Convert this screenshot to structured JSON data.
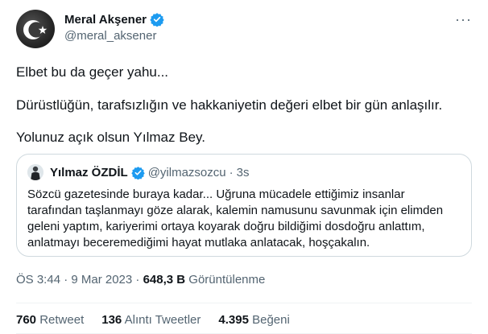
{
  "author": {
    "name": "Meral Akşener",
    "handle": "@meral_aksener",
    "verified_color": "#1d9bf0",
    "avatar_icon": "crescent-star-icon"
  },
  "tweet": {
    "lines": [
      "Elbet bu da geçer yahu...",
      "Dürüstlüğün, tarafsızlığın ve hakkaniyetin değeri elbet bir gün anlaşılır.",
      "Yolunuz açık olsun Yılmaz Bey."
    ]
  },
  "quote": {
    "name": "Yılmaz ÖZDİL",
    "handle": "@yilmazsozcu",
    "dot": "·",
    "time": "3s",
    "lines": [
      "Sözcü gazetesinde buraya kadar... Uğruna mücadele ettiğimiz insanlar",
      "tarafından taşlanmayı göze alarak, kalemin namusunu savunmak için elimden",
      "geleni yaptım, kariyerimi ortaya koyarak doğru bildiğimi dosdoğru anlattım,",
      "anlatmayı beceremediğimi hayat mutlaka anlatacak, hoşçakalın."
    ]
  },
  "meta": {
    "time_date": "ÖS 3:44 · 9 Mar 2023 · ",
    "views_count": "648,3 B",
    "views_label": " Görüntülenme"
  },
  "stats": {
    "retweets_count": "760",
    "retweets_label": "Retweet",
    "quotes_count": "136",
    "quotes_label": "Alıntı Tweetler",
    "likes_count": "4.395",
    "likes_label": "Beğeni"
  },
  "more_icon": "more-options-icon",
  "colors": {
    "text": "#0f1419",
    "secondary": "#536471",
    "border": "#cfd9de",
    "verified": "#1d9bf0"
  }
}
